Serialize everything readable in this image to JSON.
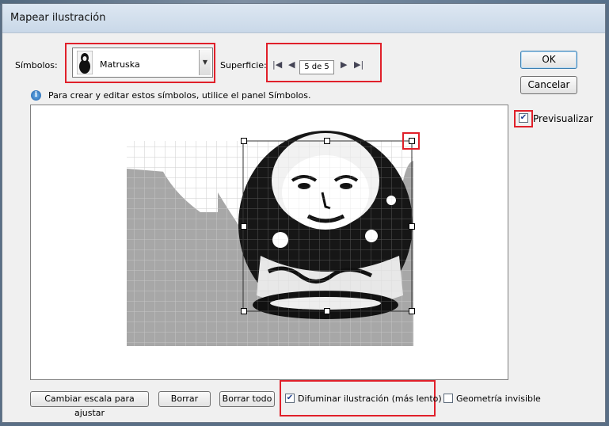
{
  "dialog": {
    "title": "Mapear ilustración"
  },
  "symbol": {
    "label": "Símbolos:",
    "selected": "Matruska",
    "dropdown_icon": "chevron-down-icon"
  },
  "surface": {
    "label": "Superficie:",
    "value": "5 de 5",
    "first_icon": "first-page-icon",
    "prev_icon": "prev-page-icon",
    "next_icon": "next-page-icon",
    "last_icon": "last-page-icon"
  },
  "info": {
    "text": "Para crear y editar estos símbolos, utilice el panel Símbolos.",
    "icon": "info-icon"
  },
  "buttons": {
    "ok": "OK",
    "cancel": "Cancelar",
    "scale_to_fit": "Cambiar escala para ajustar",
    "clear": "Borrar",
    "clear_all": "Borrar todo"
  },
  "options": {
    "preview": {
      "label": "Previsualizar",
      "checked": true
    },
    "shade": {
      "label": "Difuminar ilustración (más lento)",
      "checked": true
    },
    "invisible_geometry": {
      "label": "Geometría invisible",
      "checked": false
    }
  },
  "colors": {
    "highlight": "#e0202a",
    "surface_gray": "#a6a6a6"
  }
}
